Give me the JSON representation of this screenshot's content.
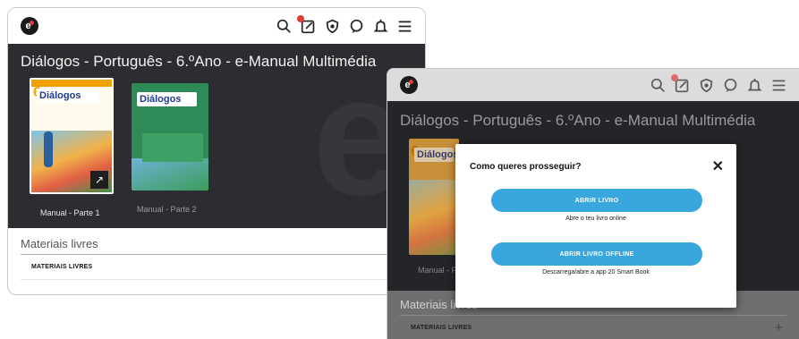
{
  "window_front": {
    "logo": "e",
    "title": "Diálogos - Português - 6.ºAno - e-Manual Multimédia",
    "books": [
      {
        "label": "Manual - Parte 1",
        "cover_title": "Diálogos",
        "cover_number": "6"
      },
      {
        "label": "Manual - Parte 2",
        "cover_title": "Diálogos"
      }
    ],
    "section_title": "Materiais livres",
    "section_row": "MATERIAIS LIVRES"
  },
  "window_overlay": {
    "logo": "e",
    "title": "Diálogos - Português - 6.ºAno - e-Manual Multimédia",
    "book_label": "Manual - Parte 1",
    "cover_number": "6",
    "cover_title": "Diálogos",
    "section_title": "Materiais livres",
    "section_row": "MATERIAIS LIVRES",
    "section_expand": "+"
  },
  "modal": {
    "title": "Como queres prosseguir?",
    "close": "✕",
    "option_1_label": "ABRIR LIVRO",
    "option_1_sub": "Abre o teu livro online",
    "option_2_label": "ABRIR LIVRO OFFLINE",
    "option_2_sub": "Descarrega/abre a app 20 Smart Book"
  },
  "icons": [
    "search-icon",
    "notes-icon",
    "shield-icon",
    "chat-icon",
    "bell-icon",
    "menu-icon"
  ],
  "colors": {
    "accent": "#3aa6de",
    "badge": "#e53935",
    "hero_bg": "#2b2d30"
  }
}
